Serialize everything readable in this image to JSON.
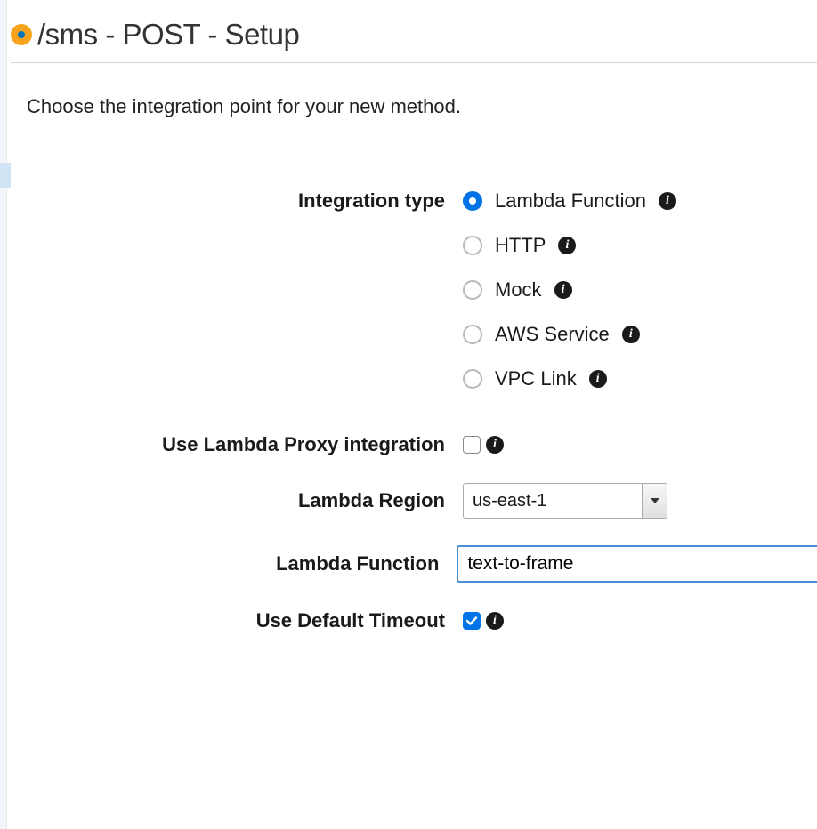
{
  "title": "/sms - POST - Setup",
  "subtitle": "Choose the integration point for your new method.",
  "labels": {
    "integration_type": "Integration type",
    "lambda_proxy": "Use Lambda Proxy integration",
    "lambda_region": "Lambda Region",
    "lambda_function": "Lambda Function",
    "default_timeout": "Use Default Timeout"
  },
  "integration_options": {
    "lambda": "Lambda Function",
    "http": "HTTP",
    "mock": "Mock",
    "aws_service": "AWS Service",
    "vpc_link": "VPC Link"
  },
  "values": {
    "integration_selected": "lambda",
    "lambda_proxy_checked": false,
    "lambda_region": "us-east-1",
    "lambda_function": "text-to-frame",
    "default_timeout_checked": true
  }
}
